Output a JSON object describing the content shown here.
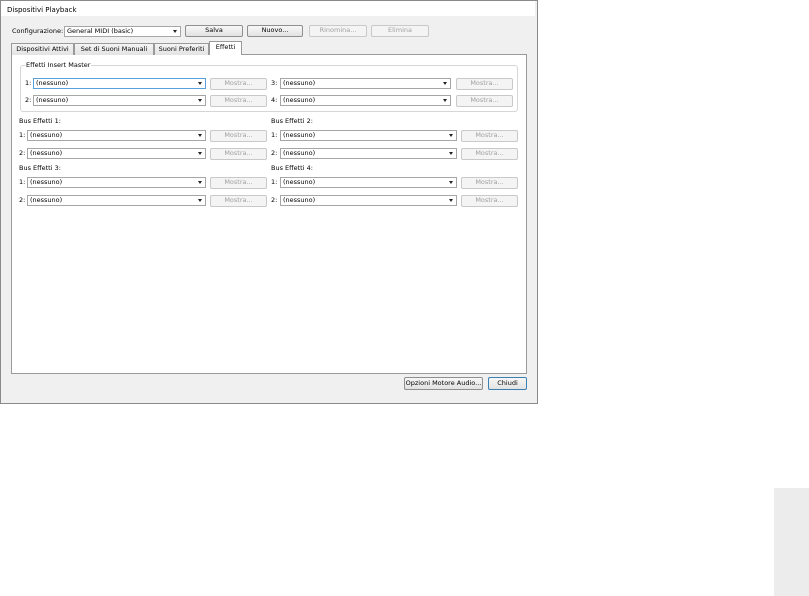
{
  "window": {
    "title": "Dispositivi Playback"
  },
  "toolbar": {
    "config_label": "Configurazione:",
    "config_value": "General MIDI (basic)",
    "save_label": "Salva",
    "new_label": "Nuovo...",
    "rename_label": "Rinomina...",
    "delete_label": "Elimina"
  },
  "tabs": [
    {
      "label": "Dispositivi Attivi"
    },
    {
      "label": "Set di Suoni Manuali"
    },
    {
      "label": "Suoni Preferiti"
    },
    {
      "label": "Effetti",
      "active": true
    }
  ],
  "master": {
    "title": "Effetti Insert Master",
    "slots": [
      {
        "num": "1:",
        "value": "(nessuno)",
        "button": "Mostra..."
      },
      {
        "num": "2:",
        "value": "(nessuno)",
        "button": "Mostra..."
      },
      {
        "num": "3:",
        "value": "(nessuno)",
        "button": "Mostra..."
      },
      {
        "num": "4:",
        "value": "(nessuno)",
        "button": "Mostra..."
      }
    ]
  },
  "buses": [
    {
      "title": "Bus Effetti 1:",
      "slots": [
        {
          "num": "1:",
          "value": "(nessuno)",
          "button": "Mostra..."
        },
        {
          "num": "2:",
          "value": "(nessuno)",
          "button": "Mostra..."
        }
      ]
    },
    {
      "title": "Bus Effetti 2:",
      "slots": [
        {
          "num": "1:",
          "value": "(nessuno)",
          "button": "Mostra..."
        },
        {
          "num": "2:",
          "value": "(nessuno)",
          "button": "Mostra..."
        }
      ]
    },
    {
      "title": "Bus Effetti 3:",
      "slots": [
        {
          "num": "1:",
          "value": "(nessuno)",
          "button": "Mostra..."
        },
        {
          "num": "2:",
          "value": "(nessuno)",
          "button": "Mostra..."
        }
      ]
    },
    {
      "title": "Bus Effetti 4:",
      "slots": [
        {
          "num": "1:",
          "value": "(nessuno)",
          "button": "Mostra..."
        },
        {
          "num": "2:",
          "value": "(nessuno)",
          "button": "Mostra..."
        }
      ]
    }
  ],
  "footer": {
    "audio_options_label": "Opzioni Motore Audio...",
    "close_label": "Chiudi"
  }
}
